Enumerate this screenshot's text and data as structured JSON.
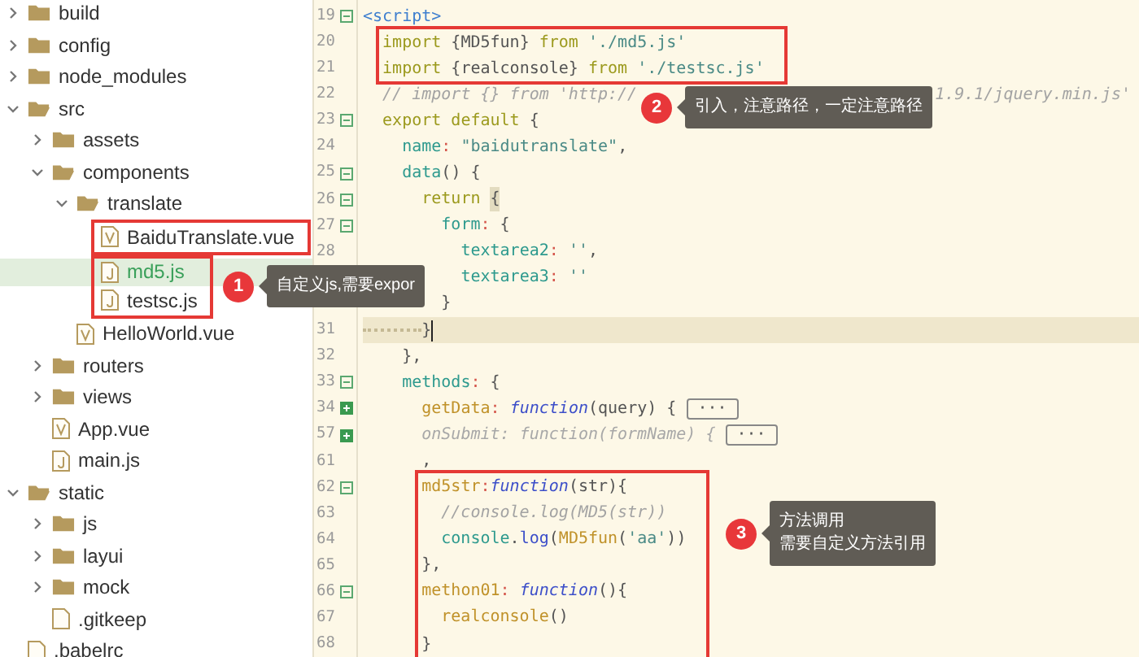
{
  "sidebar": {
    "items": [
      {
        "kind": "folder",
        "name": "build",
        "expanded": false
      },
      {
        "kind": "folder",
        "name": "config",
        "expanded": false
      },
      {
        "kind": "folder",
        "name": "node_modules",
        "expanded": false
      },
      {
        "kind": "folder",
        "name": "src",
        "expanded": true,
        "children": [
          {
            "kind": "folder",
            "name": "assets",
            "expanded": false
          },
          {
            "kind": "folder",
            "name": "components",
            "expanded": true,
            "children": [
              {
                "kind": "folder",
                "name": "translate",
                "expanded": true,
                "children": [
                  {
                    "kind": "group",
                    "boxed": true,
                    "children": [
                      {
                        "kind": "vue",
                        "name": "BaiduTranslate.vue",
                        "selected": false
                      }
                    ]
                  },
                  {
                    "kind": "group",
                    "boxed": true,
                    "children": [
                      {
                        "kind": "js",
                        "name": "md5.js",
                        "selected": true
                      },
                      {
                        "kind": "js",
                        "name": "testsc.js",
                        "selected": false
                      }
                    ]
                  }
                ]
              },
              {
                "kind": "vue",
                "name": "HelloWorld.vue",
                "selected": false
              }
            ]
          },
          {
            "kind": "folder",
            "name": "routers",
            "expanded": false
          },
          {
            "kind": "folder",
            "name": "views",
            "expanded": false
          },
          {
            "kind": "vue",
            "name": "App.vue",
            "selected": false
          },
          {
            "kind": "js",
            "name": "main.js",
            "selected": false
          }
        ]
      },
      {
        "kind": "folder",
        "name": "static",
        "expanded": true,
        "children": [
          {
            "kind": "folder",
            "name": "js",
            "expanded": false
          },
          {
            "kind": "folder",
            "name": "layui",
            "expanded": false
          },
          {
            "kind": "folder",
            "name": "mock",
            "expanded": false
          },
          {
            "kind": "plain",
            "name": ".gitkeep",
            "selected": false
          }
        ]
      },
      {
        "kind": "plain",
        "name": ".babelrc",
        "selected": false
      }
    ]
  },
  "code": [
    {
      "num": "19",
      "folded": false,
      "current": false,
      "tokens": [
        {
          "kind": "tag",
          "text": "<script>"
        }
      ],
      "children": [
        {
          "boxed": true,
          "children": [
            {
              "num": "20",
              "current": false,
              "tokens": [
                {
                  "kind": "kw",
                  "text": "import"
                },
                {
                  "kind": "punct",
                  "text": " {MD5fun} "
                },
                {
                  "kind": "kw",
                  "text": "from"
                },
                {
                  "kind": "str",
                  "text": " './md5.js'"
                }
              ]
            },
            {
              "num": "21",
              "current": false,
              "tokens": [
                {
                  "kind": "kw",
                  "text": "import"
                },
                {
                  "kind": "punct",
                  "text": " {realconsole} "
                },
                {
                  "kind": "kw",
                  "text": "from"
                },
                {
                  "kind": "str",
                  "text": " './testsc.js'"
                }
              ]
            }
          ]
        },
        {
          "num": "22",
          "current": false,
          "tokens": [
            {
              "kind": "comment",
              "text": "// import {} from 'http://"
            }
          ],
          "tail": "1.9.1/jquery.min.js'"
        },
        {
          "num": "23",
          "folded": false,
          "current": false,
          "tokens": [
            {
              "kind": "kw",
              "text": "export default"
            },
            {
              "kind": "punct",
              "text": " {"
            }
          ],
          "children": [
            {
              "num": "24",
              "current": false,
              "tokens": [
                {
                  "kind": "prop",
                  "text": "name"
                },
                {
                  "kind": "colon",
                  "text": ":"
                },
                {
                  "kind": "str",
                  "text": " \"baidutranslate\""
                },
                {
                  "kind": "punct",
                  "text": ","
                }
              ]
            },
            {
              "num": "25",
              "folded": false,
              "current": false,
              "tokens": [
                {
                  "kind": "prop",
                  "text": "data"
                },
                {
                  "kind": "punct",
                  "text": "() {"
                }
              ],
              "children": [
                {
                  "num": "26",
                  "folded": false,
                  "current": false,
                  "tokens": [
                    {
                      "kind": "kw",
                      "text": "return "
                    },
                    {
                      "kind": "match",
                      "text": "{"
                    }
                  ],
                  "children": [
                    {
                      "num": "27",
                      "folded": false,
                      "current": false,
                      "tokens": [
                        {
                          "kind": "prop",
                          "text": "form"
                        },
                        {
                          "kind": "colon",
                          "text": ":"
                        },
                        {
                          "kind": "punct",
                          "text": " {"
                        }
                      ],
                      "children": [
                        {
                          "num": "28",
                          "current": false,
                          "tokens": [
                            {
                              "kind": "prop",
                              "text": "textarea2"
                            },
                            {
                              "kind": "colon",
                              "text": ":"
                            },
                            {
                              "kind": "str",
                              "text": " ''"
                            },
                            {
                              "kind": "punct",
                              "text": ","
                            }
                          ]
                        },
                        {
                          "current": false,
                          "tokens": [
                            {
                              "kind": "prop",
                              "text": "textarea3"
                            },
                            {
                              "kind": "colon",
                              "text": ":"
                            },
                            {
                              "kind": "str",
                              "text": " ''"
                            }
                          ]
                        }
                      ]
                    },
                    {
                      "current": false,
                      "tokens": [
                        {
                          "kind": "punct",
                          "text": "}"
                        }
                      ]
                    }
                  ]
                },
                {
                  "num": "31",
                  "current": true,
                  "tokens": [
                    {
                      "kind": "punct",
                      "text": "}"
                    }
                  ]
                }
              ]
            },
            {
              "num": "32",
              "current": false,
              "tokens": [
                {
                  "kind": "punct",
                  "text": "},"
                }
              ]
            },
            {
              "num": "33",
              "folded": false,
              "current": false,
              "tokens": [
                {
                  "kind": "prop",
                  "text": "methods"
                },
                {
                  "kind": "colon",
                  "text": ":"
                },
                {
                  "kind": "punct",
                  "text": " {"
                }
              ],
              "children": [
                {
                  "num": "34",
                  "folded": true,
                  "current": false,
                  "tokens": [
                    {
                      "kind": "method",
                      "text": "getData"
                    },
                    {
                      "kind": "colon",
                      "text": ":"
                    },
                    {
                      "kind": "fn",
                      "text": " function"
                    },
                    {
                      "kind": "punct",
                      "text": "(query) { "
                    },
                    {
                      "kind": "collapsed",
                      "text": "···"
                    }
                  ]
                },
                {
                  "num": "57",
                  "folded": true,
                  "current": false,
                  "tokens": [
                    {
                      "kind": "dim",
                      "text": "onSubmit: function(formName) { "
                    },
                    {
                      "kind": "collapsed",
                      "text": "···"
                    }
                  ]
                },
                {
                  "num": "61",
                  "current": false,
                  "tokens": [
                    {
                      "kind": "punct",
                      "text": ","
                    }
                  ]
                },
                {
                  "boxed": true,
                  "children": [
                    {
                      "num": "62",
                      "folded": false,
                      "current": false,
                      "tokens": [
                        {
                          "kind": "method",
                          "text": "md5str"
                        },
                        {
                          "kind": "colon",
                          "text": ":"
                        },
                        {
                          "kind": "fn",
                          "text": "function"
                        },
                        {
                          "kind": "punct",
                          "text": "(str){"
                        }
                      ],
                      "children": [
                        {
                          "num": "63",
                          "current": false,
                          "tokens": [
                            {
                              "kind": "comment",
                              "text": "//console.log(MD5(str))"
                            }
                          ]
                        },
                        {
                          "num": "64",
                          "current": false,
                          "tokens": [
                            {
                              "kind": "prop",
                              "text": "console"
                            },
                            {
                              "kind": "punct",
                              "text": "."
                            },
                            {
                              "kind": "call",
                              "text": "log"
                            },
                            {
                              "kind": "punct",
                              "text": "("
                            },
                            {
                              "kind": "method",
                              "text": "MD5fun"
                            },
                            {
                              "kind": "punct",
                              "text": "("
                            },
                            {
                              "kind": "str",
                              "text": "'aa'"
                            },
                            {
                              "kind": "punct",
                              "text": "))"
                            }
                          ]
                        }
                      ]
                    },
                    {
                      "num": "65",
                      "current": false,
                      "tokens": [
                        {
                          "kind": "punct",
                          "text": "},"
                        }
                      ]
                    },
                    {
                      "num": "66",
                      "folded": false,
                      "current": false,
                      "tokens": [
                        {
                          "kind": "method",
                          "text": "methon01"
                        },
                        {
                          "kind": "colon",
                          "text": ":"
                        },
                        {
                          "kind": "fn",
                          "text": " function"
                        },
                        {
                          "kind": "punct",
                          "text": "(){"
                        }
                      ],
                      "children": [
                        {
                          "num": "67",
                          "current": false,
                          "tokens": [
                            {
                              "kind": "method",
                              "text": "realconsole"
                            },
                            {
                              "kind": "punct",
                              "text": "()"
                            }
                          ]
                        }
                      ]
                    },
                    {
                      "num": "68",
                      "current": false,
                      "tokens": [
                        {
                          "kind": "punct",
                          "text": "}"
                        }
                      ]
                    }
                  ]
                }
              ]
            }
          ]
        }
      ]
    }
  ],
  "callouts": [
    {
      "number": "1",
      "lines": [
        "自定义js,需要expor"
      ]
    },
    {
      "number": "2",
      "lines": [
        "引入，注意路径，一定注意路径"
      ]
    },
    {
      "number": "3",
      "lines": [
        "方法调用",
        "需要自定义方法引用"
      ]
    }
  ]
}
